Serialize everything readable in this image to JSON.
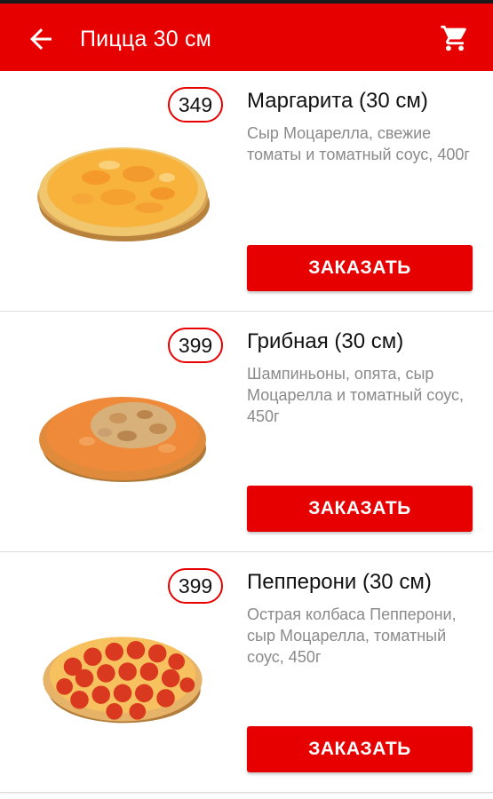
{
  "header": {
    "back_icon": "arrow-back-icon",
    "title": "Пицца 30 см",
    "cart_icon": "shopping-cart-icon"
  },
  "colors": {
    "accent": "#e60000",
    "description": "#8a8a8a"
  },
  "products": [
    {
      "price": "349",
      "name": "Маргарита (30 см)",
      "description": "Сыр Моцарелла, свежие томаты и томатный соус, 400г",
      "button_label": "ЗАКАЗАТЬ"
    },
    {
      "price": "399",
      "name": "Грибная (30 см)",
      "description": "Шампиньоны, опята, сыр Моцарелла и томатный соус, 450г",
      "button_label": "ЗАКАЗАТЬ"
    },
    {
      "price": "399",
      "name": "Пепперони (30 см)",
      "description": "Острая колбаса Пепперони, сыр Моцарелла, томатный соус, 450г",
      "button_label": "ЗАКАЗАТЬ"
    }
  ]
}
